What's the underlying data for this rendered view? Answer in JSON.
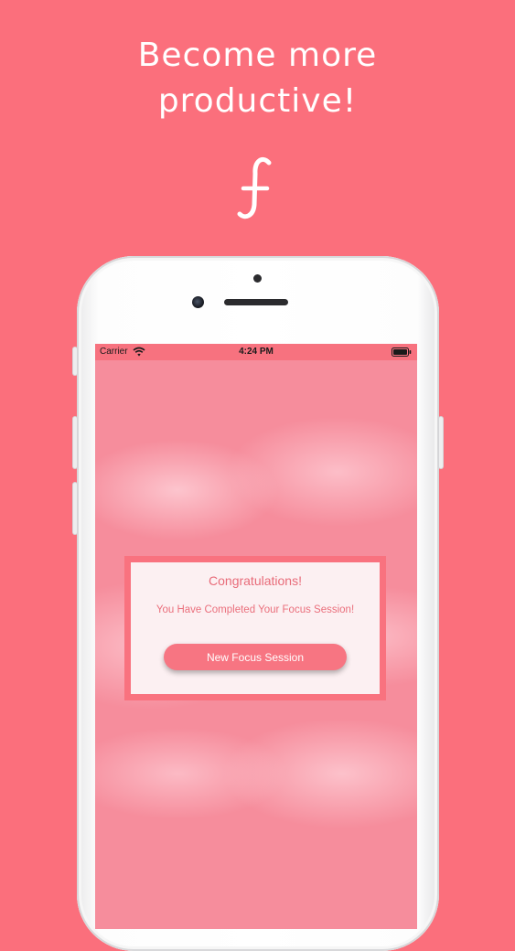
{
  "headline": {
    "line1": "Become more",
    "line2": "productive!"
  },
  "logo": {
    "icon": "cursive-f-logo",
    "color": "#ffffff"
  },
  "colors": {
    "background": "#fb6f7c",
    "accent": "#f77582",
    "dialog_text": "#e86b79"
  },
  "status_bar": {
    "carrier": "Carrier",
    "time": "4:24 PM",
    "icons": [
      "wifi-icon",
      "battery-icon"
    ]
  },
  "dialog": {
    "title": "Congratulations!",
    "message": "You Have Completed Your Focus Session!",
    "button_label": "New Focus Session"
  }
}
